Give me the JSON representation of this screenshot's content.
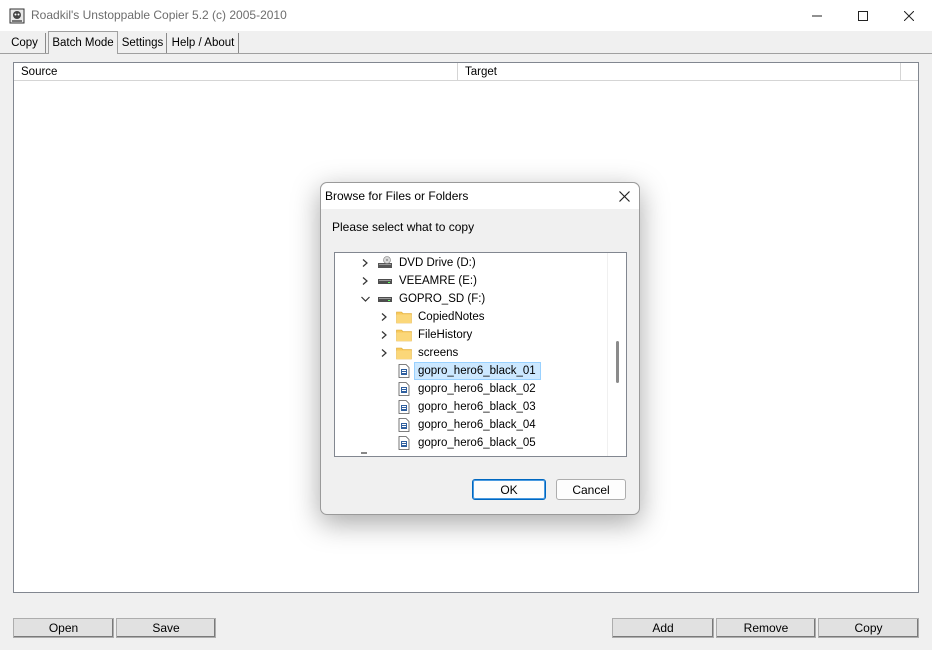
{
  "window": {
    "title": "Roadkil's Unstoppable Copier 5.2 (c) 2005-2010",
    "controls": [
      "minimize-icon",
      "maximize-icon",
      "close-icon"
    ]
  },
  "tabs": [
    {
      "label": "Copy",
      "active": false
    },
    {
      "label": "Batch Mode",
      "active": true
    },
    {
      "label": "Settings",
      "active": false
    },
    {
      "label": "Help / About",
      "active": false
    }
  ],
  "list": {
    "columns": [
      "Source",
      "Target"
    ]
  },
  "buttons": {
    "open": "Open",
    "save": "Save",
    "add": "Add",
    "remove": "Remove",
    "copy": "Copy"
  },
  "dialog": {
    "title": "Browse for Files or Folders",
    "prompt": "Please select what to copy",
    "ok": "OK",
    "cancel": "Cancel",
    "tree": [
      {
        "label": "DVD Drive (D:)",
        "icon": "dvd-drive-icon",
        "expander": "collapsed",
        "level": 0
      },
      {
        "label": "VEEAMRE (E:)",
        "icon": "drive-icon",
        "expander": "collapsed",
        "level": 0
      },
      {
        "label": "GOPRO_SD (F:)",
        "icon": "drive-icon",
        "expander": "expanded",
        "level": 0
      },
      {
        "label": "CopiedNotes",
        "icon": "folder-icon",
        "expander": "collapsed",
        "level": 1
      },
      {
        "label": "FileHistory",
        "icon": "folder-icon",
        "expander": "collapsed",
        "level": 1
      },
      {
        "label": "screens",
        "icon": "folder-icon",
        "expander": "collapsed",
        "level": 1
      },
      {
        "label": "gopro_hero6_black_01",
        "icon": "file-icon",
        "expander": "none",
        "level": 1,
        "selected": true
      },
      {
        "label": "gopro_hero6_black_02",
        "icon": "file-icon",
        "expander": "none",
        "level": 1
      },
      {
        "label": "gopro_hero6_black_03",
        "icon": "file-icon",
        "expander": "none",
        "level": 1
      },
      {
        "label": "gopro_hero6_black_04",
        "icon": "file-icon",
        "expander": "none",
        "level": 1
      },
      {
        "label": "gopro_hero6_black_05",
        "icon": "file-icon",
        "expander": "none",
        "level": 1
      }
    ]
  },
  "colors": {
    "selection": "#cce8ff",
    "selection_border": "#99d1ff",
    "folder": "#f8c95a",
    "accent": "#0067c0"
  }
}
